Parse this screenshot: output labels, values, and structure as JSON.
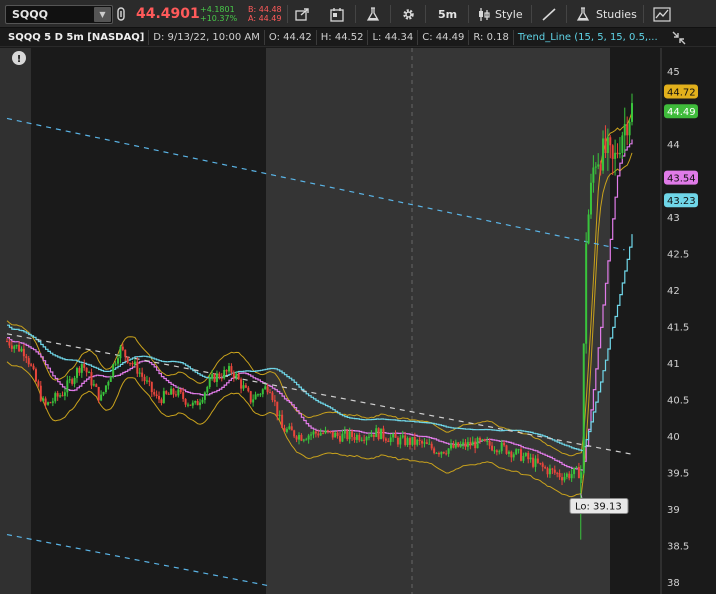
{
  "toolbar": {
    "symbol": "SQQQ",
    "last_price": "44.4901",
    "net_change": "+4.1801",
    "net_change_pct": "+10.37%",
    "bid": "B: 44.48",
    "ask": "A: 44.49",
    "timeframe": "5m",
    "style_label": "Style",
    "studies_label": "Studies",
    "icons": [
      "link-icon",
      "share-icon",
      "calendar-icon",
      "flask-icon",
      "gear-icon",
      "style-icon",
      "drawing-icon",
      "studies-icon",
      "chart-templates-icon"
    ]
  },
  "infobar": {
    "title": "SQQQ 5 D 5m [NASDAQ]",
    "date": "D: 9/13/22, 10:00 AM",
    "open": "O: 44.42",
    "high": "H: 44.52",
    "low": "L: 44.34",
    "close": "C: 44.49",
    "range": "R: 0.18",
    "study": "Trend_Line (15, 5, 15, 0.5,..."
  },
  "colors": {
    "background": "#1a1a1a",
    "session_shade": "#333333",
    "up": "#39c43c",
    "down": "#e8463c",
    "band": "#c9a21c",
    "magenta_line": "#e07be8",
    "cyan_line": "#6fd6e8",
    "dashed": "#5ab4e6",
    "dashed_white": "#cfcfcf"
  },
  "chart_data": {
    "type": "candlestick",
    "symbol": "SQQQ",
    "ylim": [
      38,
      45.8
    ],
    "y_ticks": [
      "45",
      "44.5",
      "44",
      "43.5",
      "43",
      "42.5",
      "42",
      "41.5",
      "41",
      "40.5",
      "40",
      "39.5",
      "39",
      "38.5",
      "38"
    ],
    "price_tags": [
      {
        "label": "44.72",
        "value": 44.72,
        "color": "#e2b01c"
      },
      {
        "label": "44.49",
        "value": 44.49,
        "color": "#3fbb3b"
      },
      {
        "label": "43.54",
        "value": 43.54,
        "color": "#e07be8"
      },
      {
        "label": "43.23",
        "value": 43.23,
        "color": "#6fd6e8"
      }
    ],
    "low_annotation": "Lo: 39.13",
    "low_value": 39.13,
    "price_path": [
      [
        0,
        41.3
      ],
      [
        0.03,
        41.15
      ],
      [
        0.06,
        40.4
      ],
      [
        0.09,
        40.6
      ],
      [
        0.12,
        41.0
      ],
      [
        0.15,
        40.5
      ],
      [
        0.18,
        41.2
      ],
      [
        0.21,
        40.9
      ],
      [
        0.24,
        40.5
      ],
      [
        0.27,
        40.6
      ],
      [
        0.3,
        40.4
      ],
      [
        0.33,
        40.8
      ],
      [
        0.36,
        40.9
      ],
      [
        0.39,
        40.5
      ],
      [
        0.42,
        40.7
      ],
      [
        0.44,
        40.1
      ],
      [
        0.47,
        40.0
      ],
      [
        0.5,
        40.05
      ],
      [
        0.53,
        40.0
      ],
      [
        0.56,
        40.0
      ],
      [
        0.59,
        40.05
      ],
      [
        0.62,
        39.95
      ],
      [
        0.66,
        39.9
      ],
      [
        0.69,
        39.8
      ],
      [
        0.72,
        39.85
      ],
      [
        0.75,
        39.9
      ],
      [
        0.79,
        39.85
      ],
      [
        0.83,
        39.7
      ],
      [
        0.86,
        39.55
      ],
      [
        0.89,
        39.45
      ],
      [
        0.91,
        39.5
      ],
      [
        0.92,
        39.5
      ],
      [
        0.925,
        42.6
      ],
      [
        0.94,
        43.8
      ],
      [
        0.96,
        43.9
      ],
      [
        0.97,
        43.7
      ],
      [
        0.985,
        44.2
      ],
      [
        1.0,
        44.49
      ]
    ],
    "trend_lines": [
      {
        "name": "upper-dashed",
        "style": "dashed",
        "color": "#5ab4e6",
        "points": [
          [
            0,
            44.35
          ],
          [
            0.988,
            42.55
          ]
        ]
      },
      {
        "name": "middle-dashed",
        "style": "dashed",
        "color": "#cfcfcf",
        "points": [
          [
            0,
            41.4
          ],
          [
            1.0,
            39.75
          ]
        ]
      },
      {
        "name": "lower-dashed",
        "style": "dashed",
        "color": "#5ab4e6",
        "points": [
          [
            0,
            38.65
          ],
          [
            0.418,
            37.95
          ]
        ]
      }
    ]
  }
}
